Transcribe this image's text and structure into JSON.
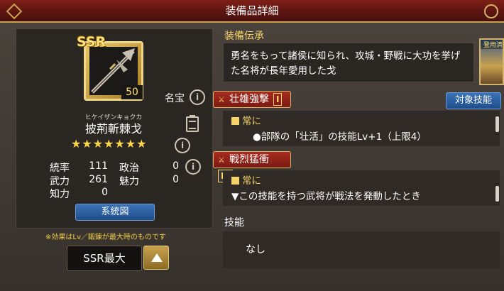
{
  "header": {
    "title": "装備品詳細"
  },
  "item": {
    "rarity": "SSR",
    "level": "50",
    "meiho_label": "名宝",
    "furigana": "ヒケイザンキョクカ",
    "name": "披荊斬棘戈",
    "stars": "★★★★★★★",
    "star_count": 7,
    "info_icon": "i"
  },
  "stats": {
    "rows": [
      {
        "label": "統率",
        "value": "111",
        "label2": "政治",
        "value2": "0"
      },
      {
        "label": "武力",
        "value": "261",
        "label2": "魅力",
        "value2": "0"
      },
      {
        "label": "知力",
        "value": "0"
      }
    ]
  },
  "left": {
    "lineage_button": "系統図",
    "note": "※効果はLv／鍛錬が最大時のものです",
    "select_value": "SSR最大"
  },
  "legend": {
    "title": "装備伝承",
    "text": "勇名をもって諸侯に知られ、攻城・野戦に大功を挙げた名将が長年愛用した戈",
    "character_label": "登用済"
  },
  "skills": [
    {
      "name": "壮雄強撃",
      "rank": "Ⅰ",
      "target_button": "対象技能",
      "condition": "常に",
      "effect_line": "●部隊の「壮活」の技能Lv+1（上限4）"
    },
    {
      "name": "戦烈猛衝",
      "rank": "Ⅳ",
      "condition": "常に",
      "effect_line": "▼この技能を持つ武将が戦法を発動したとき"
    }
  ],
  "skill_section": {
    "title": "技能",
    "value": "なし"
  },
  "colors": {
    "header": "#7e1f17",
    "accent_gold": "#f5d36a",
    "button_blue": "#2b5fa0",
    "skill_red": "#a62c1f"
  }
}
